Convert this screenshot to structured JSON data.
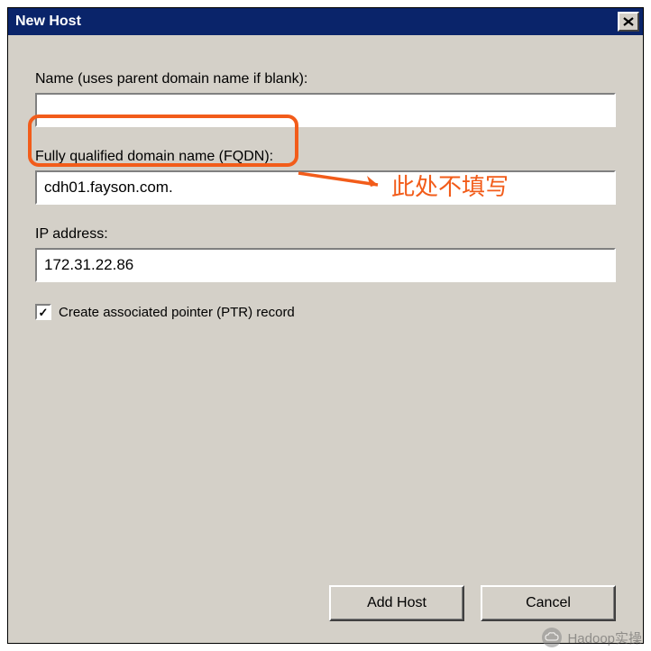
{
  "dialog": {
    "title": "New Host",
    "fields": {
      "name": {
        "label": "Name (uses parent domain name if blank):",
        "value": ""
      },
      "fqdn": {
        "label": "Fully qualified domain name (FQDN):",
        "value": "cdh01.fayson.com."
      },
      "ip": {
        "label": "IP address:",
        "value": "172.31.22.86"
      }
    },
    "checkbox": {
      "label": "Create associated pointer (PTR) record",
      "checked": true
    },
    "buttons": {
      "add": "Add Host",
      "cancel": "Cancel"
    }
  },
  "annotation": {
    "text": "此处不填写"
  },
  "watermark": {
    "text": "Hadoop实操"
  }
}
